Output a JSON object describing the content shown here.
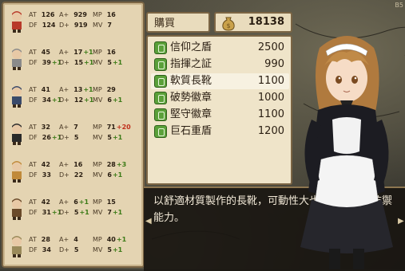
{
  "shop": {
    "title": "購買",
    "gold": "18138"
  },
  "items": [
    {
      "name": "信仰之盾",
      "price": "2500",
      "icon": "shield-icon"
    },
    {
      "name": "指揮之証",
      "price": "990",
      "icon": "badge-icon"
    },
    {
      "name": "軟質長靴",
      "price": "1100",
      "icon": "boots-icon"
    },
    {
      "name": "破勢徽章",
      "price": "1000",
      "icon": "emblem-icon"
    },
    {
      "name": "堅守徽章",
      "price": "1100",
      "icon": "emblem-icon"
    },
    {
      "name": "巨石重盾",
      "price": "1200",
      "icon": "shield-icon"
    }
  ],
  "description": "以舒適材質製作的長靴，可動性大也能提供些微防禦能力。",
  "roster": [
    {
      "at": "126",
      "a": "929",
      "mp": "16",
      "df": "124",
      "d": "919",
      "mv": "7",
      "at_b": "",
      "a_b": "",
      "mp_b": "",
      "df_b": "",
      "d_b": "",
      "mv_b": "",
      "accent": "#b83a2a"
    },
    {
      "at": "45",
      "a": "17",
      "mp": "16",
      "df": "39",
      "d": "15",
      "mv": "5",
      "at_b": "",
      "a_b": "+1",
      "mp_b": "",
      "df_b": "+1",
      "d_b": "+1",
      "mv_b": "+1",
      "accent": "#8a8a8a"
    },
    {
      "at": "41",
      "a": "13",
      "mp": "29",
      "df": "34",
      "d": "12",
      "mv": "6",
      "at_b": "",
      "a_b": "+1",
      "mp_b": "",
      "df_b": "+1",
      "d_b": "+1",
      "mv_b": "+1",
      "accent": "#3a4a6a"
    },
    {
      "at": "32",
      "a": "7",
      "mp": "71",
      "df": "26",
      "d": "5",
      "mv": "5",
      "at_b": "",
      "a_b": "",
      "mp_b": "+20",
      "df_b": "+1",
      "d_b": "",
      "mv_b": "+1",
      "accent": "#2a2a2a"
    },
    {
      "at": "42",
      "a": "16",
      "mp": "28",
      "df": "33",
      "d": "22",
      "mv": "6",
      "at_b": "",
      "a_b": "",
      "mp_b": "+3",
      "df_b": "",
      "d_b": "",
      "mv_b": "+1",
      "accent": "#c08a3a"
    },
    {
      "at": "42",
      "a": "6",
      "mp": "15",
      "df": "31",
      "d": "5",
      "mv": "7",
      "at_b": "",
      "a_b": "+1",
      "mp_b": "",
      "df_b": "+1",
      "d_b": "+1",
      "mv_b": "+1",
      "accent": "#6a4a2a"
    },
    {
      "at": "28",
      "a": "4",
      "mp": "40",
      "df": "34",
      "d": "5",
      "mv": "5",
      "at_b": "",
      "a_b": "",
      "mp_b": "+1",
      "df_b": "",
      "d_b": "",
      "mv_b": "+1",
      "accent": "#9a8a5a"
    }
  ],
  "labels": {
    "at": "AT",
    "a": "A+",
    "mp": "MP",
    "df": "DF",
    "d": "D+",
    "mv": "MV"
  },
  "corner": "B5"
}
